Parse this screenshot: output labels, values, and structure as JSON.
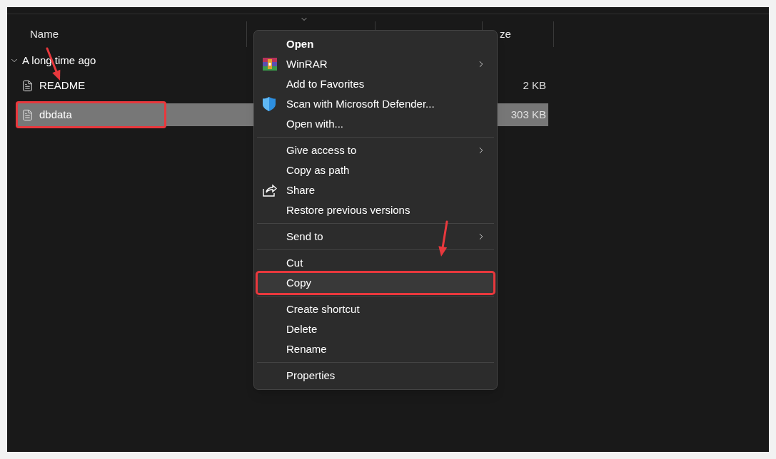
{
  "columns": {
    "name": "Name",
    "column_4": "ze"
  },
  "group": {
    "label": "A long time ago",
    "expanded": true,
    "files": [
      {
        "name": "README",
        "size": "2 KB",
        "selected": false
      },
      {
        "name": "dbdata",
        "size": "303 KB",
        "selected": true
      }
    ]
  },
  "context_menu": {
    "sections": [
      [
        {
          "label": "Open",
          "default": true,
          "kind": "plain",
          "submenu": false,
          "selected": false
        },
        {
          "label": "WinRAR",
          "default": false,
          "kind": "archive",
          "submenu": true,
          "selected": false
        },
        {
          "label": "Add to Favorites",
          "default": false,
          "kind": "plain",
          "submenu": false,
          "selected": false
        },
        {
          "label": "Scan with Microsoft Defender...",
          "default": false,
          "kind": "shield",
          "submenu": false,
          "selected": false
        },
        {
          "label": "Open with...",
          "default": false,
          "kind": "plain",
          "submenu": false,
          "selected": false
        }
      ],
      [
        {
          "label": "Give access to",
          "default": false,
          "kind": "plain",
          "submenu": true,
          "selected": false
        },
        {
          "label": "Copy as path",
          "default": false,
          "kind": "plain",
          "submenu": false,
          "selected": false
        },
        {
          "label": "Share",
          "default": false,
          "kind": "share",
          "submenu": false,
          "selected": false
        },
        {
          "label": "Restore previous versions",
          "default": false,
          "kind": "plain",
          "submenu": false,
          "selected": false
        }
      ],
      [
        {
          "label": "Send to",
          "default": false,
          "kind": "plain",
          "submenu": true,
          "selected": false
        }
      ],
      [
        {
          "label": "Cut",
          "default": false,
          "kind": "plain",
          "submenu": false,
          "selected": false
        },
        {
          "label": "Copy",
          "default": false,
          "kind": "plain",
          "submenu": false,
          "selected": true
        }
      ],
      [
        {
          "label": "Create shortcut",
          "default": false,
          "kind": "plain",
          "submenu": false,
          "selected": false
        },
        {
          "label": "Delete",
          "default": false,
          "kind": "plain",
          "submenu": false,
          "selected": false
        },
        {
          "label": "Rename",
          "default": false,
          "kind": "plain",
          "submenu": false,
          "selected": false
        }
      ],
      [
        {
          "label": "Properties",
          "default": false,
          "kind": "plain",
          "submenu": false,
          "selected": false
        }
      ]
    ]
  }
}
